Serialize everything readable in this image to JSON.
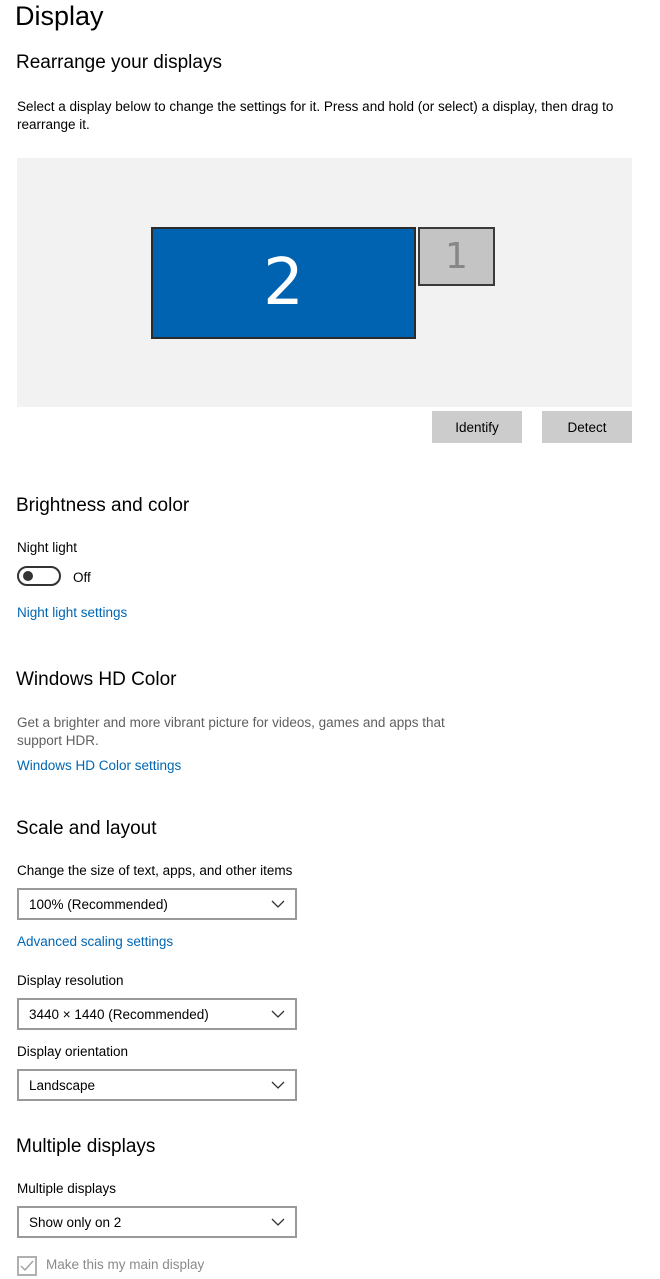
{
  "page": {
    "title": "Display"
  },
  "rearrange": {
    "title": "Rearrange your displays",
    "description": "Select a display below to change the settings for it. Press and hold (or select) a display, then drag to rearrange it.",
    "monitors": [
      {
        "number": "2",
        "selected": true,
        "color": "#0063b1"
      },
      {
        "number": "1",
        "selected": false,
        "color": "#c4c4c4"
      }
    ],
    "identify_label": "Identify",
    "detect_label": "Detect"
  },
  "brightness": {
    "title": "Brightness and color",
    "night_light_label": "Night light",
    "night_light_state": "Off",
    "night_light_on": false,
    "night_light_settings_link": "Night light settings"
  },
  "hdr": {
    "title": "Windows HD Color",
    "description": "Get a brighter and more vibrant picture for videos, games and apps that support HDR.",
    "settings_link": "Windows HD Color settings"
  },
  "scale": {
    "title": "Scale and layout",
    "size_label": "Change the size of text, apps, and other items",
    "size_value": "100% (Recommended)",
    "advanced_link": "Advanced scaling settings",
    "resolution_label": "Display resolution",
    "resolution_value": "3440 × 1440 (Recommended)",
    "orientation_label": "Display orientation",
    "orientation_value": "Landscape"
  },
  "multiple": {
    "title": "Multiple displays",
    "label": "Multiple displays",
    "value": "Show only on 2",
    "main_display_label": "Make this my main display",
    "main_display_checked": true
  },
  "colors": {
    "accent": "#0063b1",
    "link": "#0066b4",
    "button": "#cccccc",
    "arrange_background": "#f2f2f2"
  }
}
